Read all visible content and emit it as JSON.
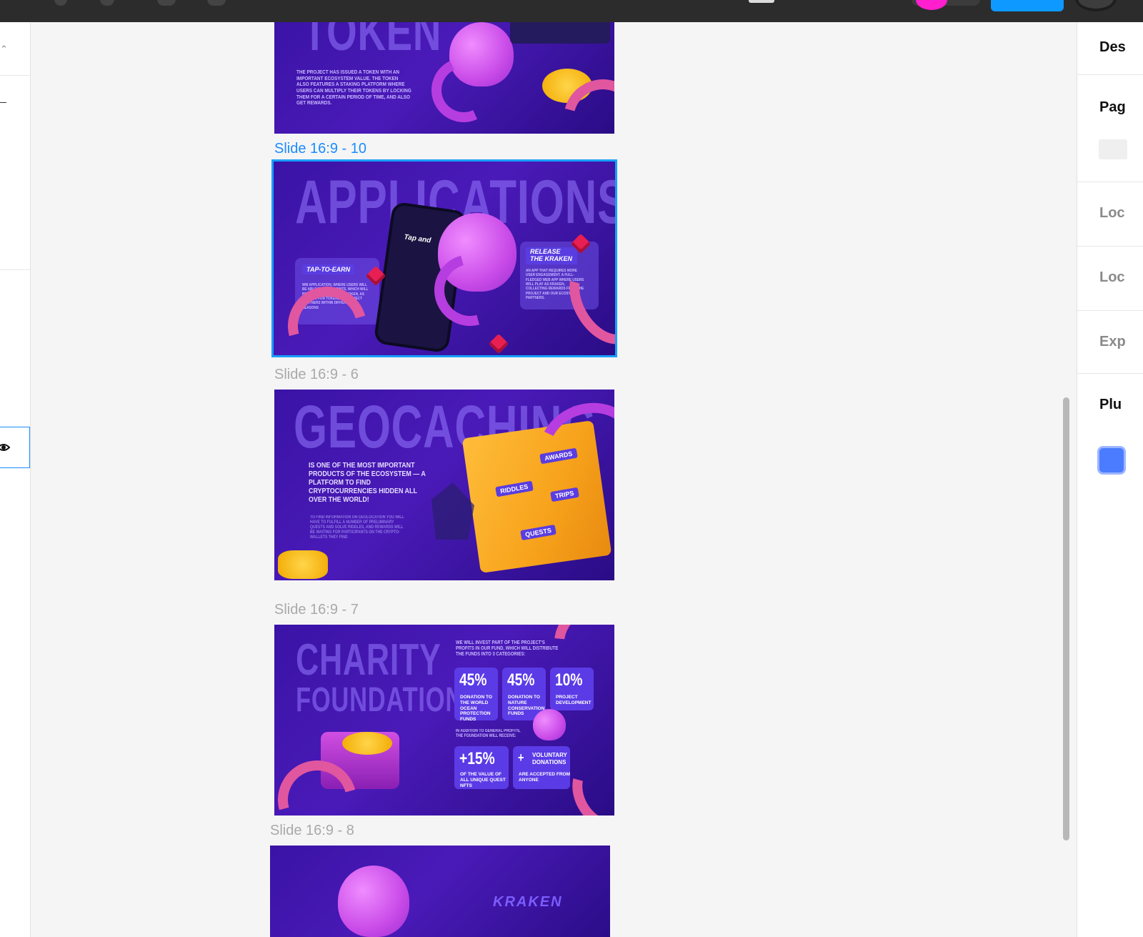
{
  "frames": [
    {
      "label": "",
      "title": "TOKEN",
      "body": "The project has issued a token with an important ecosystem value. The token also features a staking platform where users can multiply their tokens by locking them for a certain period of time, and also get rewards."
    },
    {
      "label": "Slide 16:9 - 10",
      "title": "APPLICATIONS",
      "left_badge": "Tap-to-earn",
      "left_body": "WM application, where users will be able to earn points, which will be exchanged for our token, as well as for tokens of project partners within different seasons",
      "phone_text": "Tap and",
      "right_badge": "Release the Kraken",
      "right_body": "An app that requires more user engagement. A full-fledged web app where users will play as Kraken, collecting rewards from the project and our ecosystem partners."
    },
    {
      "label": "Slide 16:9 - 6",
      "title": "GEOCACHING",
      "lead": "Is one of the most important products of the ecosystem — a platform to find cryptocurrencies hidden all over the world!",
      "body": "To find information on geolocation you will have to fulfill a number of preliminary quests and solve riddles, and rewards will be waiting for participants on the crypto-wallets they find",
      "map_tags": [
        "Awards",
        "Riddles",
        "Trips",
        "Quests"
      ]
    },
    {
      "label": "Slide 16:9 - 7",
      "title_line1": "CHARITY",
      "title_line2": "FOUNDATION",
      "intro": "We will invest part of the project's profits in our fund, which will distribute the funds into 3 categories:",
      "stats": [
        {
          "value": "45%",
          "desc": "Donation to the world ocean protection funds"
        },
        {
          "value": "45%",
          "desc": "Donation to nature conservation funds"
        },
        {
          "value": "10%",
          "desc": "Project development"
        }
      ],
      "addition": "In addition to general profits, the foundation will receive:",
      "extras": [
        {
          "value": "+15%",
          "desc": "Of the value of all unique quest NFTs"
        },
        {
          "value": "+",
          "title": "Voluntary donations",
          "desc": "Are accepted from anyone"
        }
      ]
    },
    {
      "label": "Slide 16:9 - 8",
      "logo": "KRAKEN"
    }
  ],
  "right_panel": {
    "rows": [
      "Des",
      "Pag",
      "Loc",
      "Loc",
      "Exp",
      "Plu"
    ]
  },
  "colors": {
    "selection": "#18a0fb",
    "canvas": "#f5f5f5",
    "slide_bg": "#3a13a6"
  }
}
